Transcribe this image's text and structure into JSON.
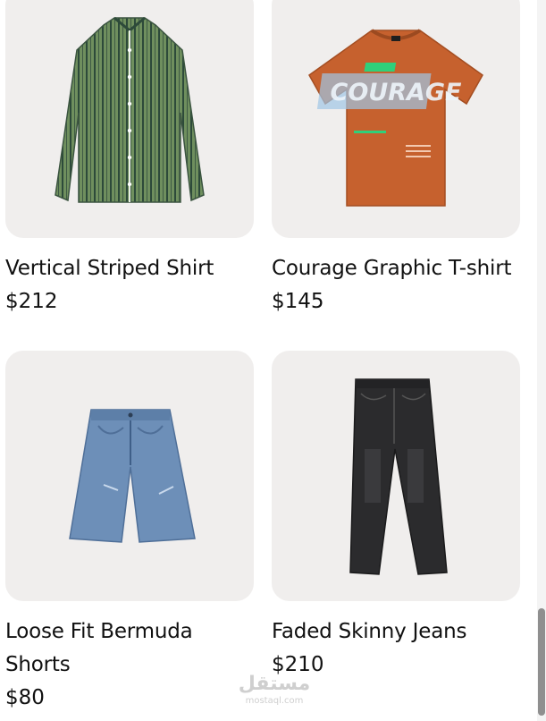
{
  "products": [
    {
      "name": "Vertical Striped Shirt",
      "price": "$212",
      "image_icon": "striped-shirt-icon"
    },
    {
      "name": "Courage Graphic T-shirt",
      "price": "$145",
      "image_icon": "graphic-tshirt-icon",
      "print_text": "COURAGE"
    },
    {
      "name": "Loose Fit Bermuda Shorts",
      "price": "$80",
      "image_icon": "denim-shorts-icon"
    },
    {
      "name": "Faded Skinny Jeans",
      "price": "$210",
      "image_icon": "skinny-jeans-icon"
    }
  ],
  "watermark": {
    "arabic": "مستقل",
    "latin": "mostaql.com"
  },
  "colors": {
    "card_background": "#f0eeed",
    "shirt_green": "#6f8f5e",
    "tshirt_orange": "#c6612e",
    "denim_blue": "#6d8fb8",
    "jeans_black": "#2b2b2d"
  }
}
